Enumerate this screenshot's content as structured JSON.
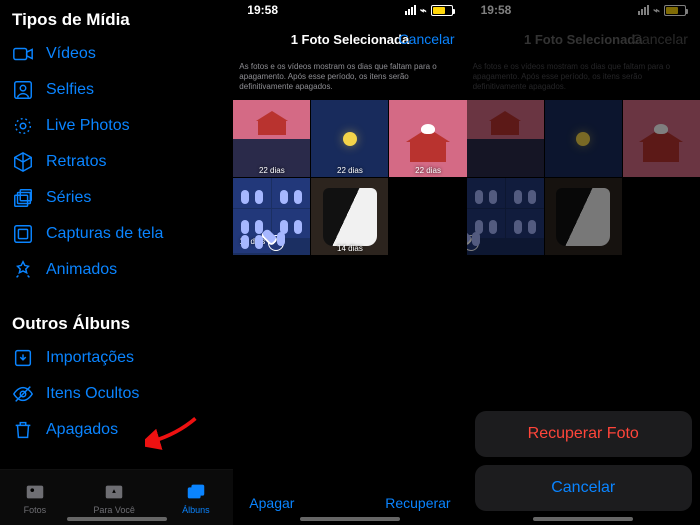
{
  "screen1": {
    "section1_title": "Tipos de Mídia",
    "items1": [
      {
        "label": "Vídeos"
      },
      {
        "label": "Selfies"
      },
      {
        "label": "Live Photos"
      },
      {
        "label": "Retratos"
      },
      {
        "label": "Séries"
      },
      {
        "label": "Capturas de tela"
      },
      {
        "label": "Animados"
      }
    ],
    "section2_title": "Outros Álbuns",
    "items2": [
      {
        "label": "Importações"
      },
      {
        "label": "Itens Ocultos"
      },
      {
        "label": "Apagados"
      }
    ],
    "tabs": {
      "fotos": "Fotos",
      "para_voce": "Para Você",
      "albuns": "Álbuns"
    }
  },
  "screen2": {
    "time": "19:58",
    "title": "1 Foto Selecionada",
    "cancel": "Cancelar",
    "info": "As fotos e os vídeos mostram os dias que faltam para o apagamento. Após esse período, os itens serão definitivamente apagados.",
    "thumbs": [
      {
        "cap": "22 dias"
      },
      {
        "cap": "22 dias"
      },
      {
        "cap": "22 dias"
      },
      {
        "cap": "14 dias"
      },
      {
        "cap": "14 dias"
      }
    ],
    "delete": "Apagar",
    "recover": "Recuperar"
  },
  "screen3": {
    "time": "19:58",
    "title": "1 Foto Selecionada",
    "cancel": "Cancelar",
    "info": "As fotos e os vídeos mostram os dias que faltam para o apagamento. Após esse período, os itens serão definitivamente apagados.",
    "sheet_recover": "Recuperar Foto",
    "sheet_cancel": "Cancelar"
  }
}
